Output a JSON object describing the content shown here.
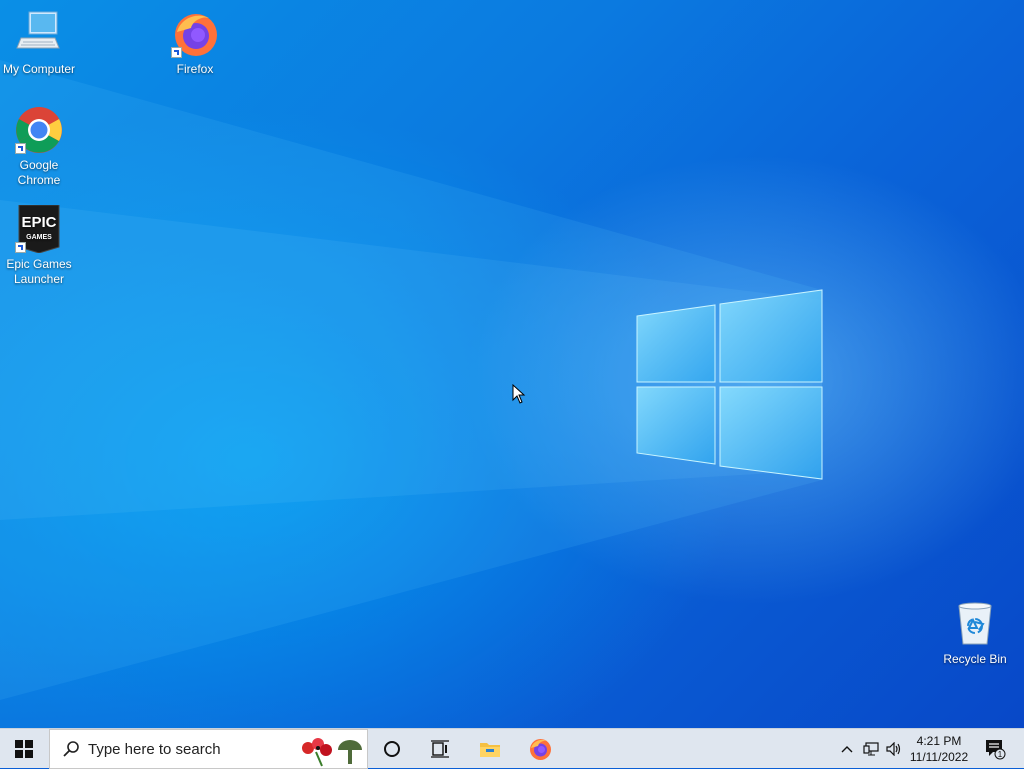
{
  "desktop": {
    "icons": [
      {
        "label": "My Computer"
      },
      {
        "label": "Firefox"
      },
      {
        "label": "Google Chrome"
      },
      {
        "label": "Epic Games Launcher"
      },
      {
        "label": "Recycle Bin"
      }
    ],
    "epic_logo_text": "EPIC",
    "epic_logo_sub": "GAMES"
  },
  "taskbar": {
    "search_placeholder": "Type here to search",
    "pinned": [
      "start-icon",
      "search-icon",
      "cortana-icon",
      "task-view-icon",
      "file-explorer-icon",
      "firefox-icon"
    ],
    "clock": {
      "time": "4:21 PM",
      "date": "11/11/2022"
    },
    "notification_count": "1"
  },
  "colors": {
    "accent": "#0a63d8",
    "taskbar": "#dfe6ef"
  }
}
